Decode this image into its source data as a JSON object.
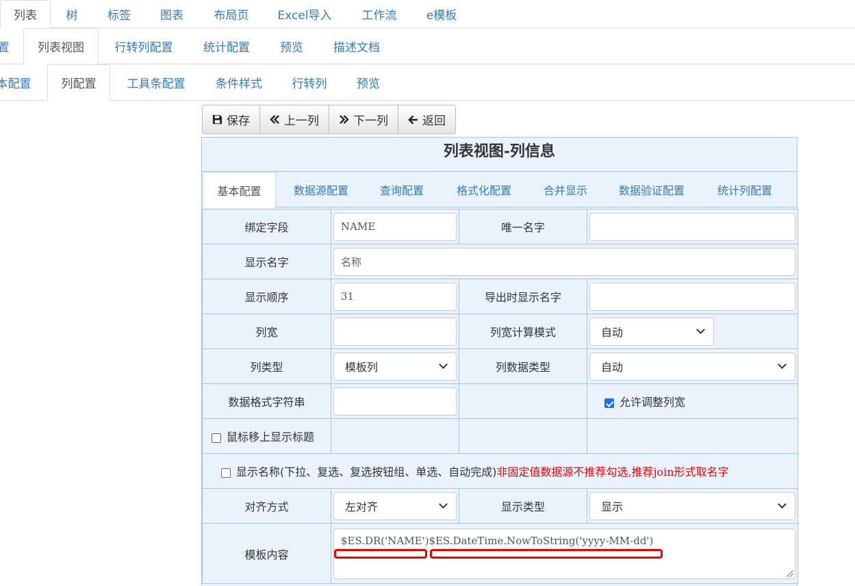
{
  "top_tabs": [
    "列表",
    "树",
    "标签",
    "图表",
    "布局页",
    "Excel导入",
    "工作流",
    "e模板"
  ],
  "second_tabs": [
    "置",
    "列表视图",
    "行转列配置",
    "统计配置",
    "预览",
    "描述文档"
  ],
  "third_tabs": [
    "本配置",
    "列配置",
    "工具条配置",
    "条件样式",
    "行转列",
    "预览"
  ],
  "toolbar": {
    "save": "保存",
    "prev": "上一列",
    "next": "下一列",
    "back": "返回"
  },
  "panel_title": "列表视图-列信息",
  "inner_tabs": [
    "基本配置",
    "数据源配置",
    "查询配置",
    "格式化配置",
    "合并显示",
    "数据验证配置",
    "统计列配置"
  ],
  "form": {
    "bind_field_label": "绑定字段",
    "bind_field_value": "NAME",
    "unique_name_label": "唯一名字",
    "unique_name_value": "",
    "display_name_label": "显示名字",
    "display_name_placeholder": "名称",
    "display_order_label": "显示顺序",
    "display_order_value": "31",
    "export_name_label": "导出时显示名字",
    "export_name_value": "",
    "col_width_label": "列宽",
    "col_width_value": "",
    "width_mode_label": "列宽计算模式",
    "width_mode_value": "自动",
    "col_type_label": "列类型",
    "col_type_value": "模板列",
    "col_data_type_label": "列数据类型",
    "col_data_type_value": "自动",
    "format_string_label": "数据格式字符串",
    "format_string_value": "",
    "allow_resize_label": "允许调整列宽",
    "allow_resize_checked": true,
    "hover_title_label": "鼠标移上显示标题",
    "hover_title_checked": false,
    "show_name_label": "显示名称(下拉、复选、复选按钮组、单选、自动完成)",
    "show_name_warning": "非固定值数据源不推荐勾选,推荐join形式取名字",
    "align_label": "对齐方式",
    "align_value": "左对齐",
    "display_type_label": "显示类型",
    "display_type_value": "显示",
    "template_label": "模板内容",
    "template_value": "$ES.DR('NAME')$ES.DateTime.NowToString('yyyy-MM-dd')"
  }
}
